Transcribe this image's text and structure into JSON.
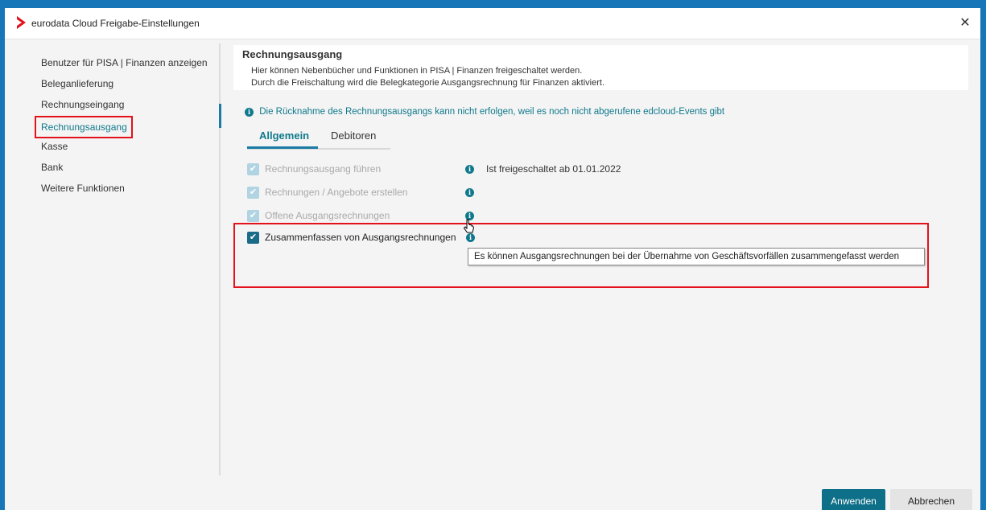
{
  "window": {
    "title": "eurodata Cloud Freigabe-Einstellungen",
    "close_symbol": "✕",
    "accent_color": "#1676b8",
    "logo_icon": "chevron-right-logo",
    "close_icon": "close-icon"
  },
  "sidebar": {
    "items": [
      {
        "label": "Benutzer für PISA | Finanzen anzeigen",
        "active": false
      },
      {
        "label": "Beleganlieferung",
        "active": false
      },
      {
        "label": "Rechnungseingang",
        "active": false
      },
      {
        "label": "Rechnungsausgang",
        "active": true
      },
      {
        "label": "Kasse",
        "active": false
      },
      {
        "label": "Bank",
        "active": false
      },
      {
        "label": "Weitere Funktionen",
        "active": false
      }
    ]
  },
  "main": {
    "section_title": "Rechnungsausgang",
    "description_lines": [
      "Hier können Nebenbücher und Funktionen in PISA | Finanzen freigeschaltet werden.",
      "Durch die Freischaltung wird die Belegkategorie Ausgangsrechnung für Finanzen aktiviert."
    ],
    "info_banner": "Die Rücknahme des Rechnungsausgangs kann nicht erfolgen, weil es noch nicht abgerufene edcloud-Events gibt",
    "info_symbol": "i",
    "tabs": [
      {
        "label": "Allgemein",
        "active": true
      },
      {
        "label": "Debitoren",
        "active": false
      }
    ],
    "options": [
      {
        "label": "Rechnungsausgang führen",
        "checked": true,
        "enabled": false,
        "status": "Ist freigeschaltet ab 01.01.2022"
      },
      {
        "label": "Rechnungen / Angebote erstellen",
        "checked": true,
        "enabled": false
      },
      {
        "label": "Offene Ausgangsrechnungen",
        "checked": true,
        "enabled": false
      },
      {
        "label": "Zusammenfassen von Ausgangsrechnungen",
        "checked": true,
        "enabled": true
      }
    ],
    "check_symbol": "✔",
    "tooltip": "Es können Ausgangsrechnungen bei der Übernahme von Geschäftsvorfällen zusammengefasst werden"
  },
  "footer": {
    "apply_label": "Anwenden",
    "cancel_label": "Abbrechen"
  },
  "colors": {
    "teal": "#10798c",
    "highlight_red": "#e3121b",
    "primary_button": "#0e6f88"
  }
}
